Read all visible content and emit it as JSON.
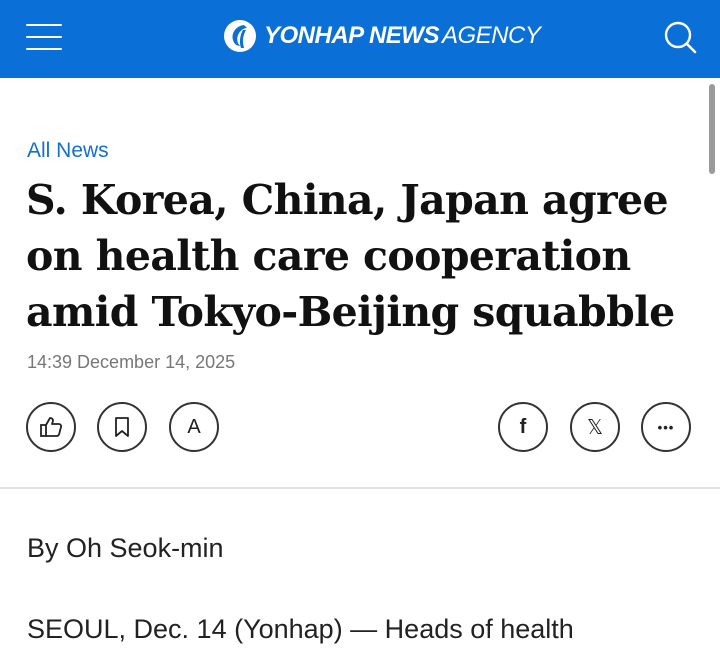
{
  "header": {
    "logo_brand": "YONHAP NEWS",
    "logo_suffix": "AGENCY",
    "menu_icon": "hamburger-menu-icon",
    "search_icon": "search-icon",
    "background_color": "#0a6fd6"
  },
  "article": {
    "section": "All News",
    "headline": "S. Korea, China, Japan agree on health care cooperation amid Tokyo-Beijing squabble",
    "timestamp": "14:39 December 14, 2025",
    "byline": "By Oh Seok-min",
    "body_start": "SEOUL, Dec. 14 (Yonhap) — Heads of health"
  },
  "actions": {
    "like_icon": "thumbs-up-icon",
    "bookmark_icon": "bookmark-icon",
    "font_size_label": "A",
    "facebook_label": "f",
    "x_label": "𝕏",
    "more_label": "•••"
  },
  "colors": {
    "link": "#1570c9",
    "headline": "#111111",
    "meta": "#777777"
  }
}
